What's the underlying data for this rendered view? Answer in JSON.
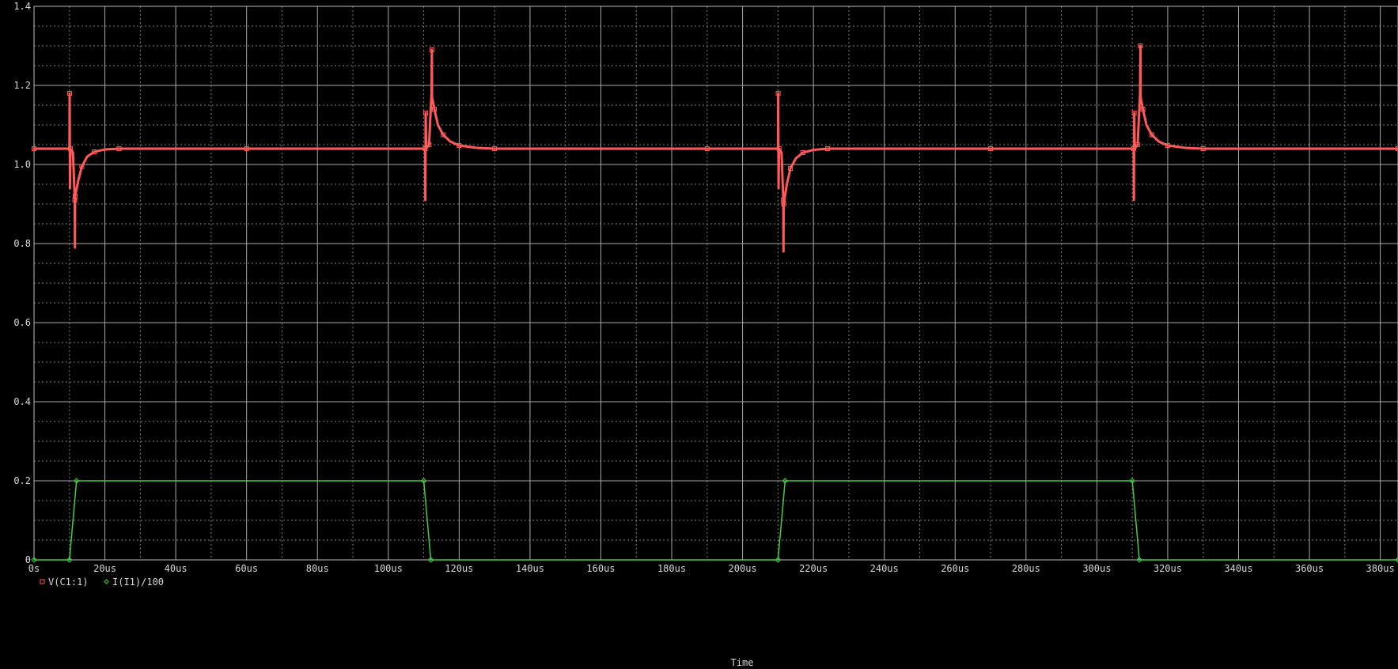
{
  "chart_data": {
    "type": "line",
    "title": "",
    "xlabel": "Time",
    "ylabel": "",
    "xlim": [
      0,
      385
    ],
    "ylim": [
      0,
      1.4
    ],
    "grid": true,
    "x_ticks": [
      0,
      20,
      40,
      60,
      80,
      100,
      120,
      140,
      160,
      180,
      200,
      220,
      240,
      260,
      280,
      300,
      320,
      340,
      360,
      380
    ],
    "x_tick_labels": [
      "0s",
      "20us",
      "40us",
      "60us",
      "80us",
      "100us",
      "120us",
      "140us",
      "160us",
      "180us",
      "200us",
      "220us",
      "240us",
      "260us",
      "280us",
      "300us",
      "320us",
      "340us",
      "360us",
      "380us"
    ],
    "y_ticks": [
      0,
      0.2,
      0.4,
      0.6,
      0.8,
      1.0,
      1.2,
      1.4
    ],
    "y_tick_labels": [
      "0",
      "0.2",
      "0.4",
      "0.6",
      "0.8",
      "1.0",
      "1.2",
      "1.4"
    ],
    "legend_position": "bottom-left",
    "series": [
      {
        "name": "V(C1:1)",
        "color": "#ff5a5a",
        "marker": "square",
        "points": [
          [
            0,
            1.04
          ],
          [
            10.0,
            1.04
          ],
          [
            10.05,
            1.18
          ],
          [
            10.15,
            0.94
          ],
          [
            10.3,
            1.04
          ],
          [
            11.0,
            1.03
          ],
          [
            11.5,
            0.91
          ],
          [
            11.55,
            0.79
          ],
          [
            11.6,
            0.92
          ],
          [
            12.5,
            0.96
          ],
          [
            13.5,
            0.995
          ],
          [
            15,
            1.02
          ],
          [
            17,
            1.032
          ],
          [
            20,
            1.038
          ],
          [
            24,
            1.04
          ],
          [
            30,
            1.04
          ],
          [
            60,
            1.04
          ],
          [
            90,
            1.04
          ],
          [
            110.4,
            1.04
          ],
          [
            110.45,
            0.91
          ],
          [
            110.55,
            1.13
          ],
          [
            110.7,
            1.04
          ],
          [
            111.5,
            1.05
          ],
          [
            112.2,
            1.18
          ],
          [
            112.3,
            1.29
          ],
          [
            112.35,
            1.17
          ],
          [
            113,
            1.14
          ],
          [
            114,
            1.1
          ],
          [
            115.5,
            1.075
          ],
          [
            117.5,
            1.058
          ],
          [
            120,
            1.048
          ],
          [
            125,
            1.042
          ],
          [
            130,
            1.04
          ],
          [
            160,
            1.04
          ],
          [
            190,
            1.04
          ],
          [
            210.0,
            1.04
          ],
          [
            210.05,
            1.18
          ],
          [
            210.15,
            0.94
          ],
          [
            210.3,
            1.04
          ],
          [
            211.0,
            1.03
          ],
          [
            211.5,
            0.91
          ],
          [
            211.55,
            0.78
          ],
          [
            211.6,
            0.9
          ],
          [
            212.5,
            0.95
          ],
          [
            213.5,
            0.99
          ],
          [
            215,
            1.015
          ],
          [
            217,
            1.03
          ],
          [
            220,
            1.037
          ],
          [
            224,
            1.04
          ],
          [
            240,
            1.04
          ],
          [
            270,
            1.04
          ],
          [
            300,
            1.04
          ],
          [
            310.4,
            1.04
          ],
          [
            310.45,
            0.91
          ],
          [
            310.55,
            1.13
          ],
          [
            310.7,
            1.04
          ],
          [
            311.5,
            1.05
          ],
          [
            312.2,
            1.18
          ],
          [
            312.3,
            1.3
          ],
          [
            312.35,
            1.17
          ],
          [
            313,
            1.14
          ],
          [
            314,
            1.1
          ],
          [
            315.5,
            1.075
          ],
          [
            317.5,
            1.058
          ],
          [
            320,
            1.048
          ],
          [
            325,
            1.042
          ],
          [
            330,
            1.04
          ],
          [
            360,
            1.04
          ],
          [
            385,
            1.04
          ]
        ]
      },
      {
        "name": "I(I1)/100",
        "color": "#3fcf3f",
        "marker": "diamond",
        "points": [
          [
            0,
            0
          ],
          [
            10,
            0
          ],
          [
            12,
            0.2
          ],
          [
            110,
            0.2
          ],
          [
            112,
            0
          ],
          [
            210,
            0
          ],
          [
            212,
            0.2
          ],
          [
            310,
            0.2
          ],
          [
            312,
            0
          ],
          [
            385,
            0
          ]
        ]
      }
    ]
  }
}
